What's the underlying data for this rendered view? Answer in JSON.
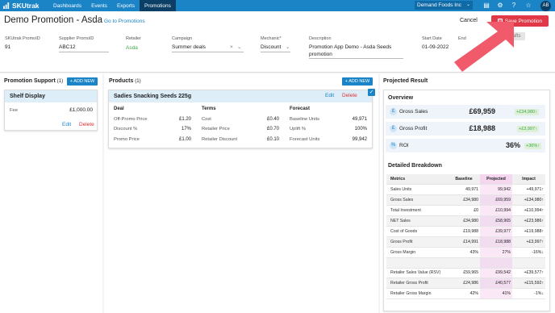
{
  "nav": {
    "logo": "SKUtrak",
    "links": [
      "Dashboards",
      "Events",
      "Exports",
      "Promotions"
    ],
    "company": "Demand Foods Inc",
    "avatar": "AB"
  },
  "header": {
    "title": "Demo Promotion - Asda",
    "goto": "Go to Promotions",
    "cancel": "Cancel",
    "save": "Save Promotion"
  },
  "fields": {
    "skutrak_label": "SKUtrak PromoID",
    "skutrak_value": "91",
    "supplier_label": "Supplier PromoID",
    "supplier_value": "ABC12",
    "retailer_label": "Retailer",
    "retailer_value": "Asda",
    "campaign_label": "Campaign",
    "campaign_value": "Summer deals",
    "mechanic_label": "Mechanic*",
    "mechanic_value": "Discount",
    "description_label": "Description",
    "description_value": "Promotion App Demo - Asda Seeds promotion",
    "start_label": "Start Date",
    "start_value": "01-09-2022",
    "end_label": "End",
    "end_value": "22",
    "status_label": "Status",
    "status_value": "Drafts"
  },
  "support": {
    "title": "Promotion Support",
    "count": "(1)",
    "add": "+ ADD NEW",
    "card_title": "Shelf Display",
    "fee_label": "Fee",
    "fee_value": "£1,000.00",
    "edit": "Edit",
    "delete": "Delete"
  },
  "products": {
    "title": "Products",
    "count": "(1)",
    "add": "+ ADD NEW",
    "card_title": "Sadies Snacking Seeds 225g",
    "edit": "Edit",
    "delete": "Delete",
    "deal_head": "Deal",
    "terms_head": "Terms",
    "forecast_head": "Forecast",
    "deal": [
      {
        "label": "Off-Promo Price",
        "value": "£1.20"
      },
      {
        "label": "Discount %",
        "value": "17%"
      },
      {
        "label": "Promo Price",
        "value": "£1.00"
      }
    ],
    "terms": [
      {
        "label": "Cost",
        "value": "£0.40"
      },
      {
        "label": "Retailer Price",
        "value": "£0.70"
      },
      {
        "label": "Retailer Discount",
        "value": "£0.10"
      }
    ],
    "forecast": [
      {
        "label": "Baseline Units",
        "value": "49,971"
      },
      {
        "label": "Uplift %",
        "value": "100%"
      },
      {
        "label": "Forecast Units",
        "value": "99,942"
      }
    ]
  },
  "projected": {
    "title": "Projected Result",
    "overview": "Overview",
    "metrics": [
      {
        "label": "Gross Sales",
        "value": "£69,959",
        "badge": "+£34,980↑",
        "icon": "£"
      },
      {
        "label": "Gross Profit",
        "value": "£18,988",
        "badge": "+£3,997↑",
        "icon": "£"
      },
      {
        "label": "ROI",
        "value": "36%",
        "badge": "+36%↑",
        "icon": "%"
      }
    ],
    "breakdown_title": "Detailed Breakdown",
    "columns": [
      "Metrics",
      "Baseline",
      "Projected",
      "Impact"
    ],
    "rows": [
      {
        "m": "Sales Units",
        "b": "49,971",
        "p": "99,942",
        "i": "+49,971↑",
        "dir": "up"
      },
      {
        "m": "Gross Sales",
        "b": "£34,980",
        "p": "£69,959",
        "i": "+£34,980↑",
        "dir": "up"
      },
      {
        "m": "Total Investment",
        "b": "£0",
        "p": "£10,994",
        "i": "+£10,994↑",
        "dir": "up"
      },
      {
        "m": "NET Sales",
        "b": "£34,980",
        "p": "£58,965",
        "i": "+£23,986↑",
        "dir": "up"
      },
      {
        "m": "Cost of Goods",
        "b": "£19,988",
        "p": "£39,977",
        "i": "+£19,988↑",
        "dir": "up"
      },
      {
        "m": "Gross Profit",
        "b": "£14,991",
        "p": "£18,988",
        "i": "+£3,997↑",
        "dir": "up"
      },
      {
        "m": "Gross Margin",
        "b": "43%",
        "p": "27%",
        "i": "-16%↓",
        "dir": "dn"
      },
      {
        "m": "",
        "b": "",
        "p": "",
        "i": "",
        "dir": ""
      },
      {
        "m": "Retailer Sales Value (RSV)",
        "b": "£59,965",
        "p": "£99,542",
        "i": "+£39,577↑",
        "dir": "up"
      },
      {
        "m": "Retailer Gross Profit",
        "b": "£24,986",
        "p": "£40,577",
        "i": "+£15,592↑",
        "dir": "up"
      },
      {
        "m": "Retailer Gross Margin",
        "b": "42%",
        "p": "41%",
        "i": "-1%↓",
        "dir": "dn"
      }
    ]
  }
}
